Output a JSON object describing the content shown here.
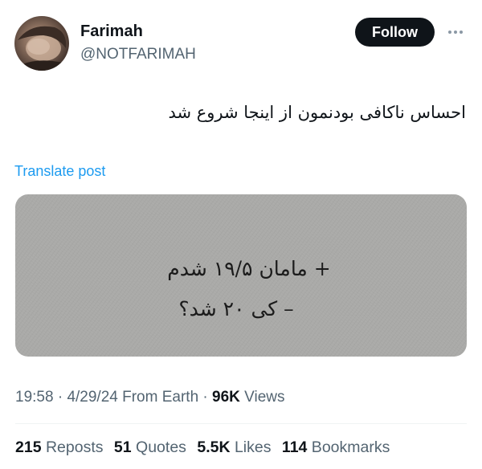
{
  "author": {
    "name": "Farimah",
    "handle": "@NOTFARIMAH"
  },
  "header": {
    "follow_label": "Follow",
    "more_icon": "more-horizontal-icon"
  },
  "post": {
    "text": "احساس ناکافی بودنمون از اینجا شروع شد",
    "translate_label": "Translate post",
    "image_text": {
      "line1": "+ مامان ۱۹/۵ شدم",
      "line2": "– کی ۲۰ شد؟"
    }
  },
  "meta": {
    "time": "19:58",
    "sep1": " · ",
    "date": "4/29/24",
    "source": " From Earth",
    "sep2": " · ",
    "views_count": "96K",
    "views_label": " Views"
  },
  "stats": {
    "reposts_count": "215",
    "reposts_label": " Reposts",
    "quotes_count": "51",
    "quotes_label": " Quotes",
    "likes_count": "5.5K",
    "likes_label": " Likes",
    "bookmarks_count": "114",
    "bookmarks_label": " Bookmarks"
  },
  "colors": {
    "accent": "#1d9bf0",
    "text_primary": "#0f1419",
    "text_secondary": "#536471",
    "follow_bg": "#0f1419",
    "media_bg": "#aaaaa8"
  }
}
